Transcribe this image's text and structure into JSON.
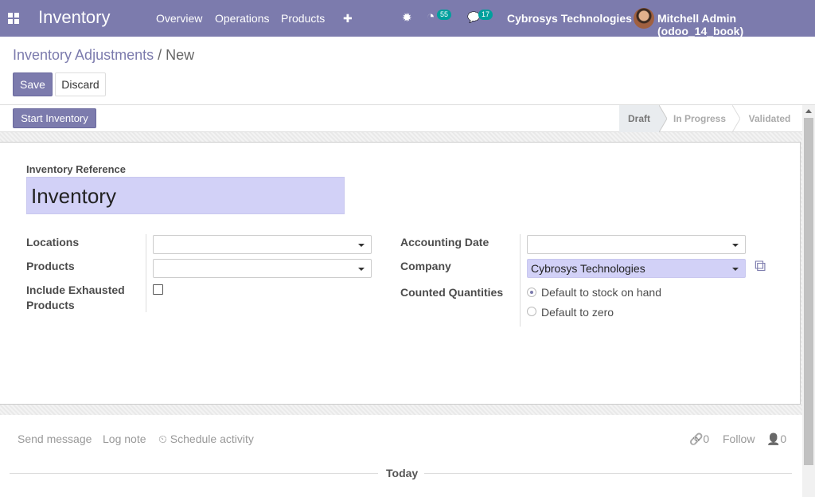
{
  "topbar": {
    "app_name": "Inventory",
    "menu": [
      "Overview",
      "Operations",
      "Products"
    ],
    "plus_glyph": "✚",
    "bug_glyph": "✹",
    "activity_glyph": "◔",
    "activity_count": "55",
    "messages_glyph": "💬",
    "messages_count": "17",
    "company": "Cybrosys Technologies",
    "user": "Mitchell Admin (odoo_14_book)"
  },
  "breadcrumb": {
    "parent": "Inventory Adjustments",
    "separator": "/",
    "current": "New"
  },
  "buttons": {
    "save": "Save",
    "discard": "Discard",
    "start": "Start Inventory"
  },
  "statusbar": {
    "stages": [
      "Draft",
      "In Progress",
      "Validated"
    ],
    "active": "Draft"
  },
  "form": {
    "reference_label": "Inventory Reference",
    "reference_value": "Inventory",
    "locations_label": "Locations",
    "products_label": "Products",
    "exhausted_label_1": "Include Exhausted",
    "exhausted_label_2": "Products",
    "accounting_date_label": "Accounting Date",
    "company_label": "Company",
    "company_value": "Cybrosys Technologies",
    "counted_label": "Counted Quantities",
    "counted_options": [
      "Default to stock on hand",
      "Default to zero"
    ],
    "counted_selected": "Default to stock on hand",
    "external_link_glyph": "⧉"
  },
  "chatter": {
    "send_message": "Send message",
    "log_note": "Log note",
    "schedule_activity": "⏲ Schedule activity",
    "attachments": "🔗0",
    "follow": "Follow",
    "followers": "👤0",
    "today": "Today"
  },
  "colors": {
    "accent": "#7c7bad",
    "badge": "#00a09d",
    "field_highlight": "#d2d1f7"
  }
}
